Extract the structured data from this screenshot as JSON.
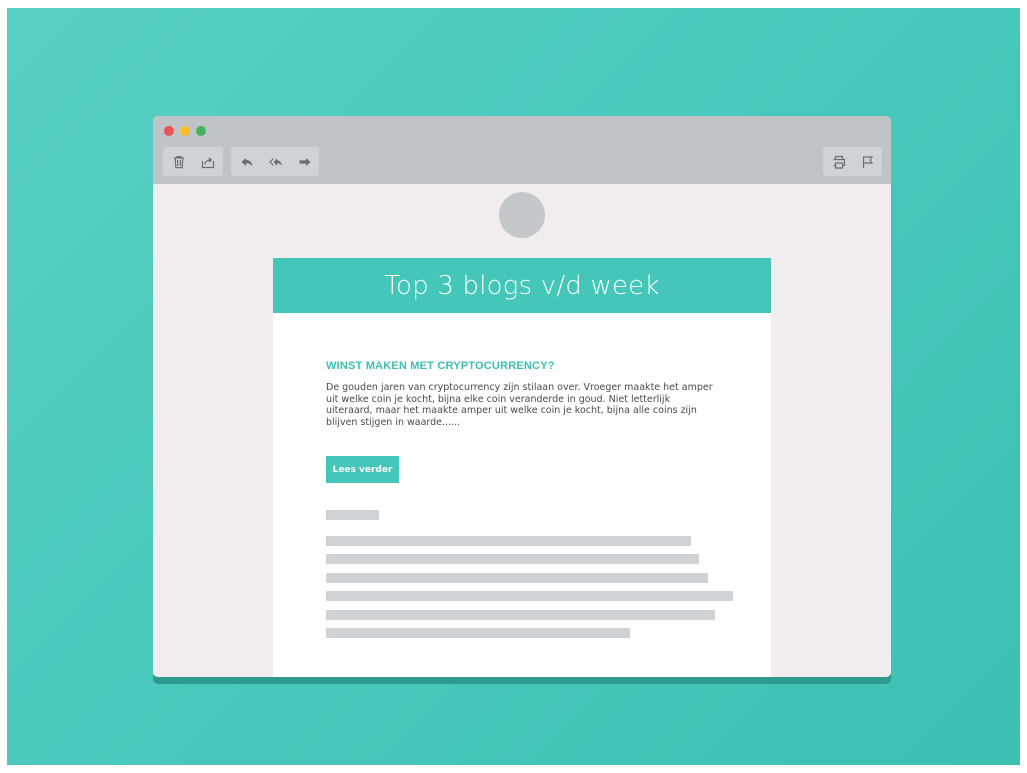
{
  "toolbar": {
    "left_group_1": [
      "trash-icon",
      "move-to-icon"
    ],
    "left_group_2": [
      "reply-icon",
      "reply-all-icon",
      "forward-icon"
    ],
    "right_group": [
      "print-icon",
      "flag-icon"
    ]
  },
  "email": {
    "header_title": "Top 3 blogs v/d week",
    "post": {
      "title": "WINST MAKEN MET CRYPTOCURRENCY?",
      "body": "De gouden jaren van cryptocurrency zijn stilaan over. Vroeger maakte het amper uit welke coin je kocht, bijna elke coin veranderde in goud. Niet letterlijk uiteraard, maar het maakte amper uit welke coin je kocht, bijna alle coins zijn blijven stijgen in waarde......",
      "button_label": "Lees verder"
    }
  },
  "colors": {
    "background": "#49c9bb",
    "accent": "#44c6b8",
    "titlebar": "#c0c4c7",
    "placeholder": "#cfd3d6"
  }
}
